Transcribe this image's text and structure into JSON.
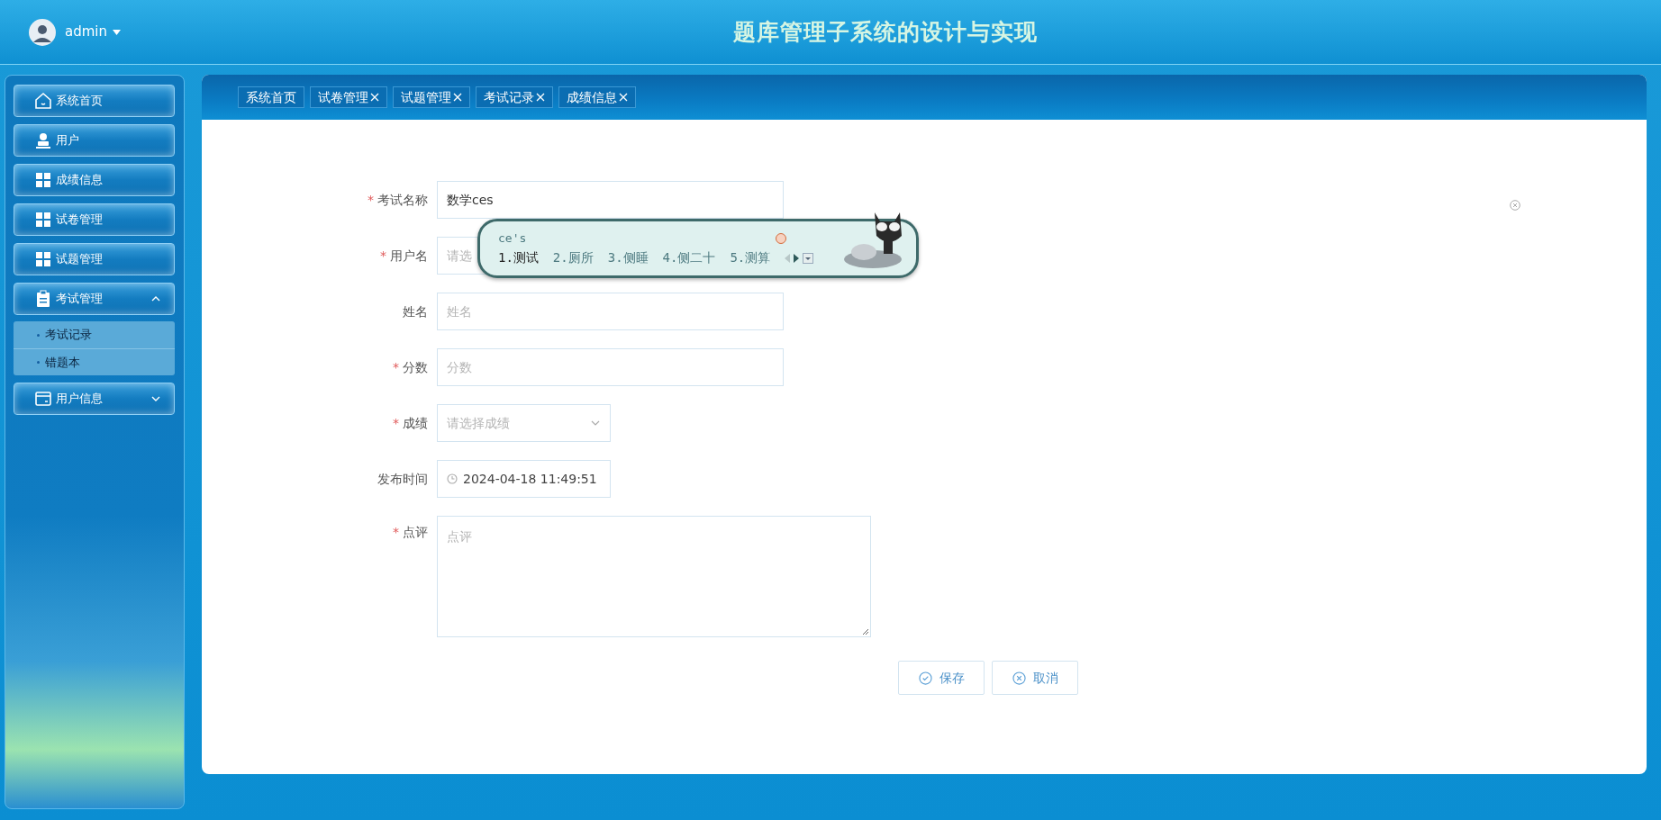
{
  "header": {
    "user": "admin",
    "title": "题库管理子系统的设计与实现"
  },
  "sidebar": {
    "items": [
      {
        "label": "系统首页",
        "kind": "link"
      },
      {
        "label": "用户",
        "kind": "link"
      },
      {
        "label": "成绩信息",
        "kind": "link"
      },
      {
        "label": "试卷管理",
        "kind": "link"
      },
      {
        "label": "试题管理",
        "kind": "link"
      },
      {
        "label": "考试管理",
        "kind": "group",
        "expanded": true,
        "children": [
          {
            "label": "考试记录"
          },
          {
            "label": "错题本"
          }
        ]
      },
      {
        "label": "用户信息",
        "kind": "group",
        "expanded": false
      }
    ]
  },
  "tabs": [
    {
      "label": "系统首页",
      "closable": false
    },
    {
      "label": "试卷管理",
      "closable": true
    },
    {
      "label": "试题管理",
      "closable": true
    },
    {
      "label": "考试记录",
      "closable": true
    },
    {
      "label": "成绩信息",
      "closable": true
    }
  ],
  "form": {
    "fields": [
      {
        "label": "考试名称",
        "required_mark": "*",
        "kind": "text",
        "value": "数学ces"
      },
      {
        "label": "用户名",
        "required_mark": "*",
        "kind": "text",
        "placeholder": "请选"
      },
      {
        "label": "姓名",
        "kind": "text",
        "placeholder": "姓名"
      },
      {
        "label": "分数",
        "required_mark": "*",
        "kind": "text",
        "placeholder": "分数"
      },
      {
        "label": "成绩",
        "required_mark": "*",
        "kind": "select",
        "placeholder": "请选择成绩"
      },
      {
        "label": "发布时间",
        "kind": "datetime",
        "value": "2024-04-18 11:49:51"
      },
      {
        "label": "点评",
        "required_mark": "*",
        "kind": "textarea",
        "placeholder": "点评"
      }
    ],
    "buttons": [
      {
        "label": "保存",
        "kind": "save"
      },
      {
        "label": "取消",
        "kind": "cancel"
      }
    ]
  },
  "ime": {
    "input": "ce's",
    "candidates": [
      {
        "label": "1.测试",
        "selected": true
      },
      {
        "label": "2.厕所",
        "selected": false
      },
      {
        "label": "3.侧睡",
        "selected": false
      },
      {
        "label": "4.侧二十",
        "selected": false
      },
      {
        "label": "5.测算",
        "selected": false
      }
    ]
  }
}
